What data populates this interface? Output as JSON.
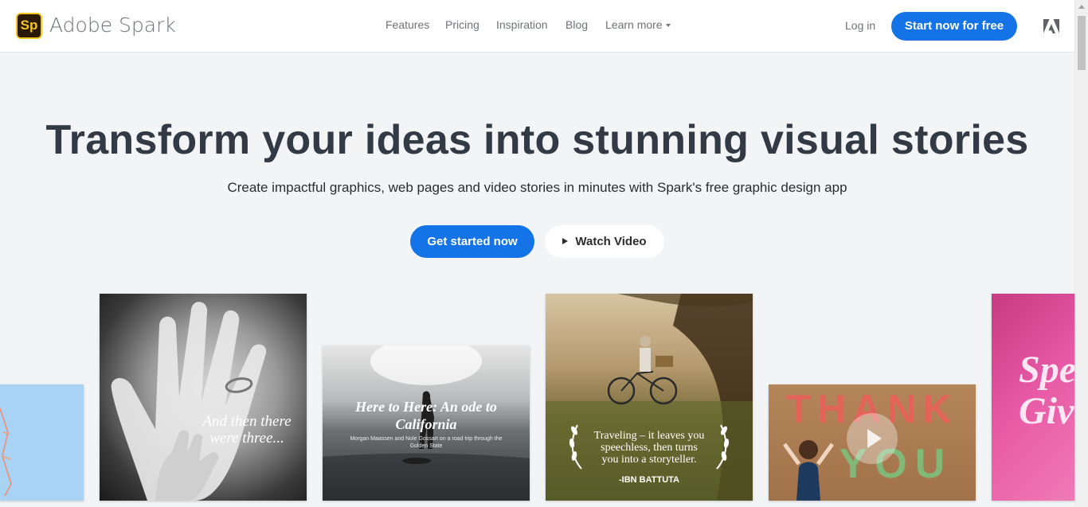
{
  "header": {
    "logo_badge": "Sp",
    "logo_text": "Adobe Spark",
    "nav": [
      {
        "label": "Features"
      },
      {
        "label": "Pricing"
      },
      {
        "label": "Inspiration"
      },
      {
        "label": "Blog"
      },
      {
        "label": "Learn more"
      }
    ],
    "login": "Log in",
    "cta": "Start now for free"
  },
  "hero": {
    "title": "Transform your ideas into stunning visual stories",
    "subtitle": "Create impactful graphics, web pages and video stories in minutes with Spark's free graphic design app",
    "primary_button": "Get started now",
    "secondary_button": "Watch Video"
  },
  "cards": {
    "hands": {
      "line1": "And then there",
      "line2": "were three..."
    },
    "surfer": {
      "title1": "Here to Here: An ode to",
      "title2": "California",
      "caption1": "Morgan Maassen and Nole Gossart on a road trip through the",
      "caption2": "Golden State"
    },
    "quote": {
      "line1": "Traveling – it leaves you",
      "line2": "speechless, then turns",
      "line3": "you into a storyteller.",
      "author": "-IBN BATTUTA"
    },
    "thankyou": {
      "letters1": "THANK",
      "letters2": "YOU"
    },
    "pink": {
      "line1": "Spe",
      "line2": "Giv"
    }
  },
  "colors": {
    "accent": "#1473e6",
    "title": "#323a45",
    "background": "#f3f4f6",
    "logo_yellow": "#f3c620"
  }
}
